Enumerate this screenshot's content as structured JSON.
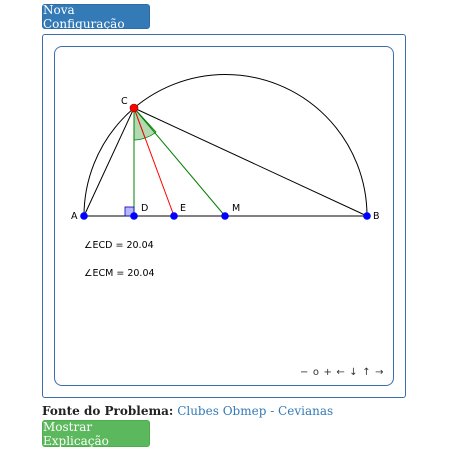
{
  "buttons": {
    "new_config": "Nova Configuração",
    "show_explanation": "Mostrar Explicação"
  },
  "points": {
    "A": "A",
    "B": "B",
    "C": "C",
    "D": "D",
    "E": "E",
    "M": "M"
  },
  "measures": {
    "ecd": "∠ECD = 20.04",
    "ecm": "∠ECM = 20.04"
  },
  "nav": {
    "zoom_out": "−",
    "reset": "o",
    "zoom_in": "+",
    "left": "←",
    "down": "↓",
    "up": "↑",
    "right": "→"
  },
  "source": {
    "label": "Fonte do Problema:",
    "link": "Clubes Obmep - Cevianas"
  },
  "colors": {
    "point_blue": "#0000ff",
    "point_c": "#ff0000",
    "altitude_median": "#008000",
    "bisector": "#ff0000",
    "angle_fill": "#7fbf7f",
    "right_angle_fill": "#9999ff"
  }
}
